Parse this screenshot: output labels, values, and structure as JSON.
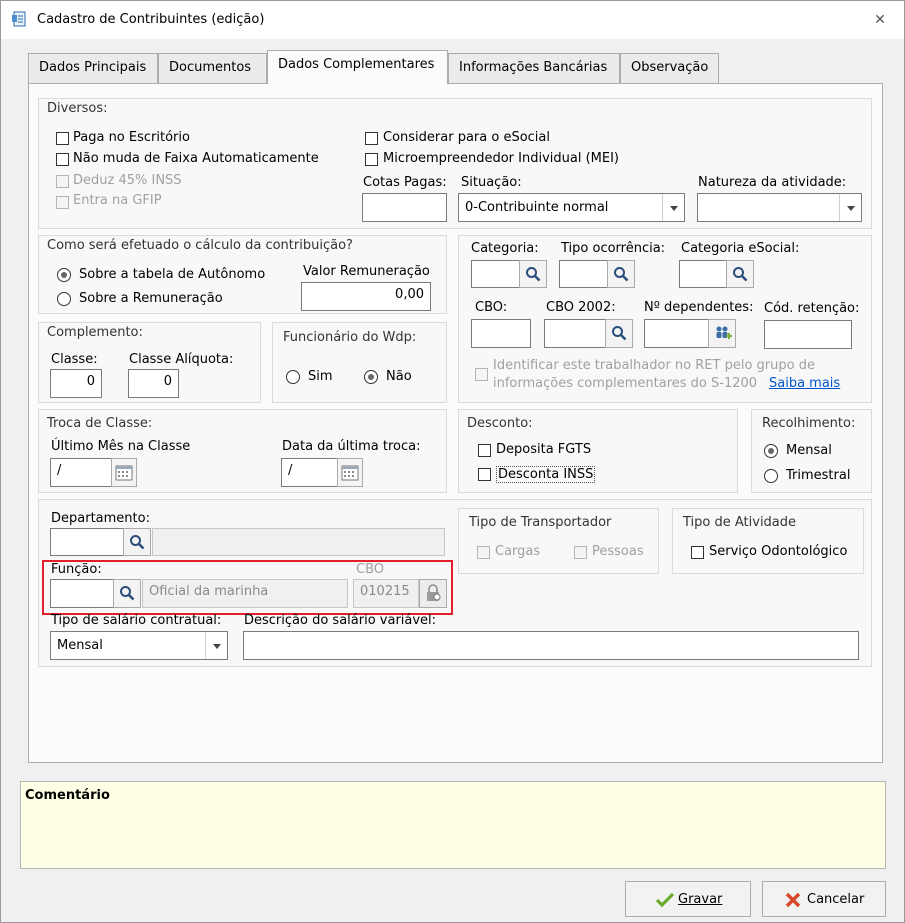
{
  "window": {
    "title": "Cadastro de Contribuintes (edição)"
  },
  "tabs": [
    {
      "label": "Dados Principais"
    },
    {
      "label": "Documentos"
    },
    {
      "label": "Dados Complementares"
    },
    {
      "label": "Informações Bancárias"
    },
    {
      "label": "Observação"
    }
  ],
  "diversos": {
    "title": "Diversos:",
    "paga_escritorio": "Paga no Escritório",
    "nao_muda_faixa": "Não muda de Faixa Automaticamente",
    "deduz_inss": "Deduz 45% INSS",
    "entra_gfip": "Entra na GFIP",
    "considerar_esocial": "Considerar para o eSocial",
    "mei": "Microempreendedor Individual (MEI)",
    "cotas_pagas_label": "Cotas Pagas:",
    "cotas_pagas_value": "",
    "situacao_label": "Situação:",
    "situacao_value": "0-Contribuinte normal",
    "natureza_label": "Natureza da atividade:",
    "natureza_value": ""
  },
  "calculo": {
    "title": "Como será efetuado o cálculo da contribuição?",
    "opt_tabela": "Sobre a tabela de Autônomo",
    "opt_remuneracao": "Sobre a Remuneração",
    "valor_label": "Valor Remuneração",
    "valor_value": "0,00"
  },
  "categoria": {
    "categoria_label": "Categoria:",
    "tipo_ocorrencia_label": "Tipo ocorrência:",
    "categoria_esocial_label": "Categoria eSocial:",
    "cbo_label": "CBO:",
    "cbo2002_label": "CBO 2002:",
    "dependentes_label": "Nº dependentes:",
    "cod_retencao_label": "Cód. retenção:",
    "ret_text_1": "Identificar este trabalhador no RET pelo grupo de",
    "ret_text_2": "informações complementares do S-1200",
    "saiba_mais": "Saiba mais"
  },
  "complemento": {
    "title": "Complemento:",
    "classe_label": "Classe:",
    "classe_value": "0",
    "aliquota_label": "Classe Alíquota:",
    "aliquota_value": "0"
  },
  "funcionario": {
    "title": "Funcionário do Wdp:",
    "sim": "Sim",
    "nao": "Não"
  },
  "troca": {
    "title": "Troca de Classe:",
    "ultimo_mes_label": "Último Mês na Classe",
    "ultimo_mes_value": "/",
    "data_troca_label": "Data da última troca:",
    "data_troca_value": "/"
  },
  "desconto": {
    "title": "Desconto:",
    "deposita_fgts": "Deposita FGTS",
    "desconta_inss": "Desconta INSS"
  },
  "recolhimento": {
    "title": "Recolhimento:",
    "mensal": "Mensal",
    "trimestral": "Trimestral"
  },
  "departamento": {
    "label": "Departamento:",
    "code": "",
    "desc": ""
  },
  "transportador": {
    "title": "Tipo de Transportador",
    "cargas": "Cargas",
    "pessoas": "Pessoas"
  },
  "atividade": {
    "title": "Tipo de Atividade",
    "odontologico": "Serviço Odontológico"
  },
  "funcao": {
    "label": "Função:",
    "code": "",
    "desc": "Oficial da marinha",
    "cbo_label": "CBO",
    "cbo_value": "010215"
  },
  "salario": {
    "tipo_label": "Tipo de salário contratual:",
    "tipo_value": "Mensal",
    "descricao_label": "Descrição do salário variável:",
    "descricao_value": ""
  },
  "comentario": {
    "title": "Comentário"
  },
  "actions": {
    "gravar": "Gravar",
    "cancelar": "Cancelar"
  },
  "colors": {
    "highlight": "#e0202c",
    "comment_bg": "#ffffe6",
    "link": "#0055cc"
  },
  "icons": [
    "document-icon",
    "close-icon",
    "search-icon",
    "calendar-icon",
    "lock-icon",
    "people-add-icon",
    "check-icon",
    "x-icon"
  ]
}
